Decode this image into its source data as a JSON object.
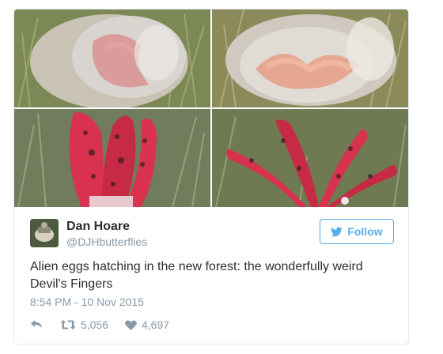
{
  "tweet": {
    "author": {
      "display_name": "Dan Hoare",
      "handle": "@DJHbutterflies",
      "avatar_icon": "profile-photo"
    },
    "follow_label": "Follow",
    "text": "Alien eggs hatching in the new forest: the wonderfully weird Devil's Fingers",
    "timestamp": "8:54 PM - 10 Nov 2015",
    "actions": {
      "reply_icon": "reply-icon",
      "retweet_count": "5,056",
      "like_count": "4,697"
    },
    "media": [
      {
        "icon": "photo-egg-closed"
      },
      {
        "icon": "photo-egg-opening"
      },
      {
        "icon": "photo-fingers-emerging"
      },
      {
        "icon": "photo-fingers-spread"
      }
    ]
  },
  "colors": {
    "accent": "#55acee",
    "muted": "#8899a6",
    "text": "#292f33",
    "border": "#e1e8ed",
    "fungus_red": "#d8324e"
  }
}
